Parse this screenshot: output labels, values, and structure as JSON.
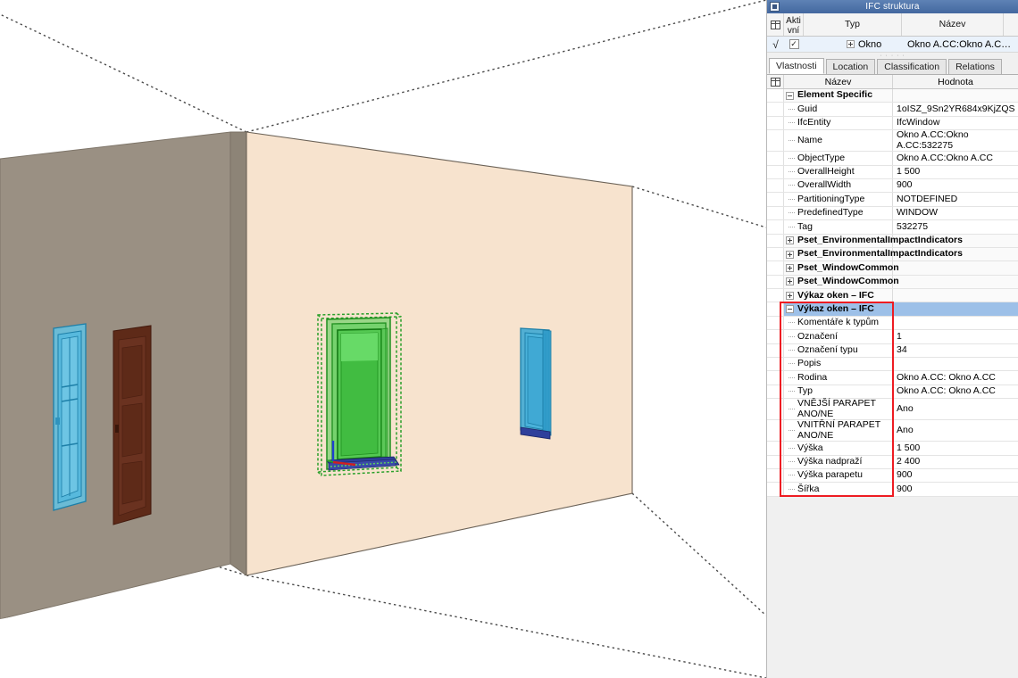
{
  "window": {
    "title": "IFC struktura",
    "icon": "window-restore-icon"
  },
  "tree": {
    "columns": [
      "",
      "Akti\nvní",
      "Typ",
      "Název"
    ],
    "col_icon": "grid-settings-icon",
    "col_active_line1": "Akti",
    "col_active_line2": "vní",
    "col_type": "Typ",
    "col_name": "Název",
    "row": {
      "marker": "√",
      "checked": "✓",
      "expander": "expand-plus-icon",
      "type": "Okno",
      "name": "Okno A.CC:Okno A.C…"
    },
    "splitter_dots": "· · · · ·"
  },
  "tabs": [
    {
      "label": "Vlastnosti",
      "active": true
    },
    {
      "label": "Location",
      "active": false
    },
    {
      "label": "Classification",
      "active": false
    },
    {
      "label": "Relations",
      "active": false
    }
  ],
  "property_grid": {
    "col_icon": "grid-settings-icon",
    "col_name": "Název",
    "col_value": "Hodnota",
    "rows": [
      {
        "kind": "group",
        "expander": "minus",
        "name": "Element Specific",
        "value": ""
      },
      {
        "kind": "item",
        "name": "Guid",
        "value": "1oISZ_9Sn2YR684x9KjZQS"
      },
      {
        "kind": "item",
        "name": "IfcEntity",
        "value": "IfcWindow"
      },
      {
        "kind": "item",
        "name": "Name",
        "value": "Okno A.CC:Okno A.CC:532275"
      },
      {
        "kind": "item",
        "name": "ObjectType",
        "value": "Okno A.CC:Okno A.CC"
      },
      {
        "kind": "item",
        "name": "OverallHeight",
        "value": "1 500"
      },
      {
        "kind": "item",
        "name": "OverallWidth",
        "value": "900"
      },
      {
        "kind": "item",
        "name": "PartitioningType",
        "value": "NOTDEFINED"
      },
      {
        "kind": "item",
        "name": "PredefinedType",
        "value": "WINDOW"
      },
      {
        "kind": "item",
        "name": "Tag",
        "value": "532275"
      },
      {
        "kind": "group",
        "expander": "plus",
        "name": "Pset_EnvironmentalImpactIndicators",
        "value": ""
      },
      {
        "kind": "group",
        "expander": "plus",
        "name": "Pset_EnvironmentalImpactIndicators",
        "value": ""
      },
      {
        "kind": "group",
        "expander": "plus",
        "name": "Pset_WindowCommon",
        "value": ""
      },
      {
        "kind": "group",
        "expander": "plus",
        "name": "Pset_WindowCommon",
        "value": ""
      },
      {
        "kind": "group",
        "expander": "plus",
        "name": "Výkaz oken – IFC",
        "value": ""
      },
      {
        "kind": "group",
        "expander": "minus",
        "name": "Výkaz oken – IFC",
        "value": "",
        "selected": true
      },
      {
        "kind": "item",
        "name": "Komentáře k typům",
        "value": ""
      },
      {
        "kind": "item",
        "name": "Označení",
        "value": "1"
      },
      {
        "kind": "item",
        "name": "Označení typu",
        "value": "34"
      },
      {
        "kind": "item",
        "name": "Popis",
        "value": ""
      },
      {
        "kind": "item",
        "name": "Rodina",
        "value": "Okno A.CC: Okno A.CC"
      },
      {
        "kind": "item",
        "name": "Typ",
        "value": "Okno A.CC: Okno A.CC"
      },
      {
        "kind": "item",
        "name": "VNĚJŠÍ PARAPET ANO/NE",
        "value": "Ano",
        "tall": true
      },
      {
        "kind": "item",
        "name": "VNITŘNÍ PARAPET ANO/NE",
        "value": "Ano",
        "tall": true
      },
      {
        "kind": "item",
        "name": "Výška",
        "value": "1 500"
      },
      {
        "kind": "item",
        "name": "Výška nadpraží",
        "value": "2 400"
      },
      {
        "kind": "item",
        "name": "Výška parapetu",
        "value": "900"
      },
      {
        "kind": "item",
        "name": "Šířka",
        "value": "900"
      }
    ]
  },
  "highlight": {
    "color": "#ee1c22",
    "name": "vykaz-oken-ifc-highlight"
  },
  "viewport": {
    "name": "ifc-3d-model-viewport",
    "colors": {
      "background": "#ffffff",
      "wall_left": "#9a9083",
      "wall_left_edge": "#8a8176",
      "wall_front": "#f7e3ce",
      "outline": "#6b6257",
      "guide_line": "#4a4a4a",
      "selection_green": "#2aa02a",
      "selection_fill": "#45c845",
      "window_blue": "#3fa9d4",
      "door_brown": "#5e2a18",
      "axis_blue": "#1f3fd0",
      "axis_red": "#d02020"
    },
    "objects": [
      {
        "name": "wall-left",
        "type": "wall"
      },
      {
        "name": "wall-front",
        "type": "wall"
      },
      {
        "name": "window-left-blue",
        "type": "window"
      },
      {
        "name": "door-brown",
        "type": "door"
      },
      {
        "name": "window-selected-green",
        "type": "window",
        "selected": true
      },
      {
        "name": "window-right-blue",
        "type": "window"
      }
    ]
  }
}
